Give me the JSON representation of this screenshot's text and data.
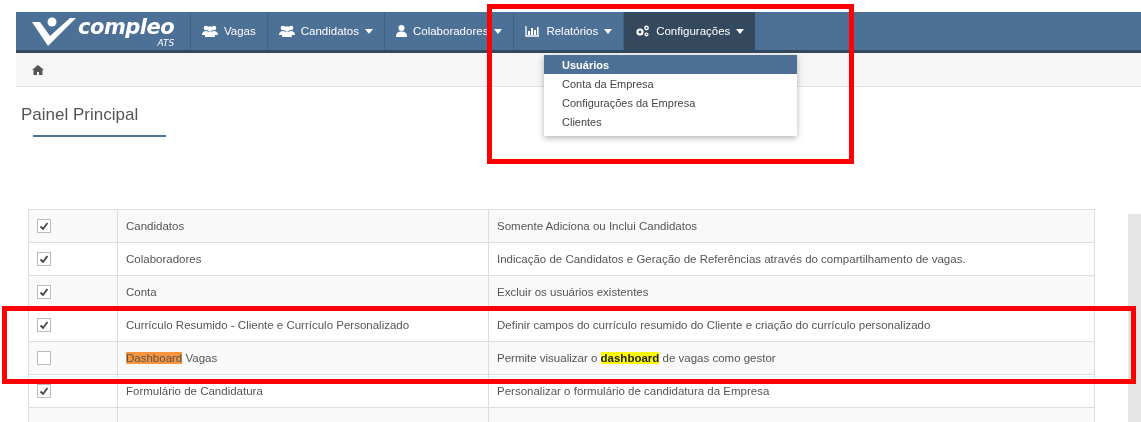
{
  "logo": {
    "name": "compleo",
    "suffix": "ATS"
  },
  "nav": [
    {
      "label": "Vagas",
      "kind": "users",
      "dropdown": false,
      "selected": false
    },
    {
      "label": "Candidatos",
      "kind": "users",
      "dropdown": true,
      "selected": false
    },
    {
      "label": "Colaboradores",
      "kind": "user",
      "dropdown": true,
      "selected": false
    },
    {
      "label": "Relatórios",
      "kind": "chart",
      "dropdown": true,
      "selected": false
    },
    {
      "label": "Configurações",
      "kind": "gears",
      "dropdown": true,
      "selected": true
    }
  ],
  "dropdown_menu": [
    {
      "label": "Usuários",
      "selected": true
    },
    {
      "label": "Conta da Empresa",
      "selected": false
    },
    {
      "label": "Configurações da Empresa",
      "selected": false
    },
    {
      "label": "Clientes",
      "selected": false
    }
  ],
  "page_title": "Painel Principal",
  "permissions": [
    {
      "checked": true,
      "name": [
        {
          "text": "Candidatos"
        }
      ],
      "description": [
        {
          "text": "Somente Adiciona ou Inclui Candidatos"
        }
      ]
    },
    {
      "checked": true,
      "name": [
        {
          "text": "Colaboradores"
        }
      ],
      "description": [
        {
          "text": "Indicação de Candidatos e Geração de Referências através do compartilhamento de vagas."
        }
      ]
    },
    {
      "checked": true,
      "name": [
        {
          "text": "Conta"
        }
      ],
      "description": [
        {
          "text": "Excluir os usuários existentes"
        }
      ]
    },
    {
      "checked": true,
      "name": [
        {
          "text": "Currículo Resumido - Cliente e Currículo Personalizado"
        }
      ],
      "description": [
        {
          "text": "Definir campos do currículo resumido do Cliente e criação do currículo personalizado"
        }
      ]
    },
    {
      "checked": false,
      "name": [
        {
          "text": "Dashboard",
          "color": "#f7943c"
        },
        {
          "text": " Vagas"
        }
      ],
      "description": [
        {
          "text": "Permite visualizar o "
        },
        {
          "text": "dashboard",
          "color": "#ffff00",
          "bold": true
        },
        {
          "text": " de vagas como gestor"
        }
      ]
    },
    {
      "checked": true,
      "name": [
        {
          "text": "Formulário de Candidatura"
        }
      ],
      "description": [
        {
          "text": "Personalizar o formulário de candidatura da Empresa"
        }
      ]
    }
  ]
}
